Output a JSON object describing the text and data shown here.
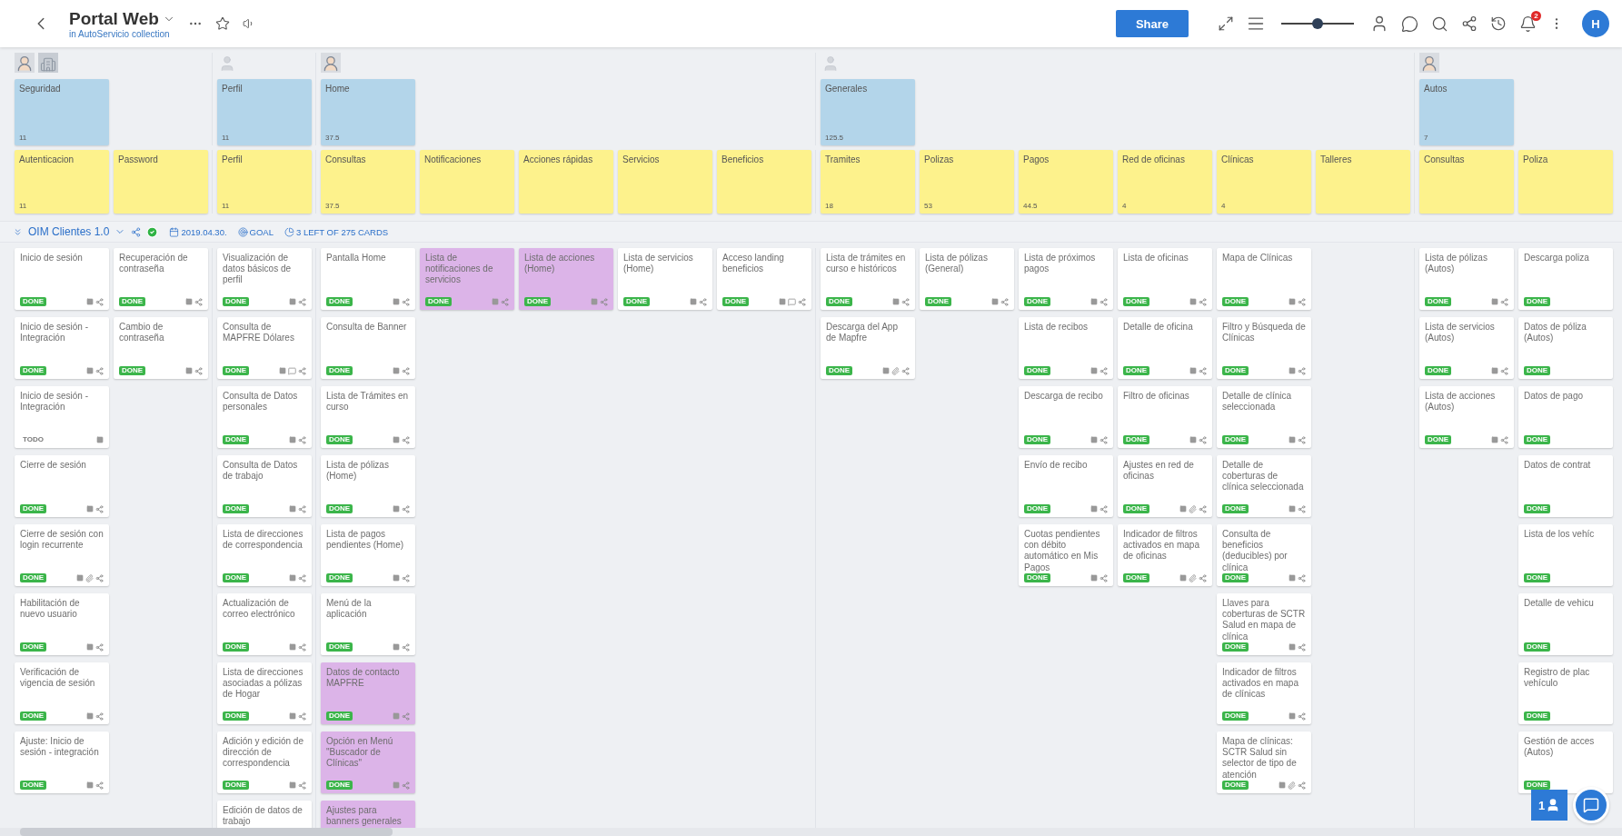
{
  "header": {
    "title": "Portal Web",
    "subtitle": "in AutoServicio collection",
    "share": "Share",
    "zoom": {
      "level": 0.5
    },
    "notifications": "2",
    "user_initial": "H"
  },
  "release": {
    "name": "OIM Clientes 1.0",
    "complete": true,
    "date": "2019.04.30.",
    "goal": "GOAL",
    "cards_left": "3 LEFT OF 275 CARDS"
  },
  "groups": [
    {
      "activity": {
        "title": "Seguridad",
        "value": "11"
      },
      "avatars": [
        {
          "kind": "person"
        },
        {
          "kind": "building"
        }
      ],
      "columns": [
        {
          "step": {
            "title": "Autenticacion",
            "value": "11"
          },
          "cards": [
            {
              "title": "Inicio de sesión",
              "status": "DONE",
              "done": true,
              "color": "#ffffff",
              "note": true,
              "share": true
            },
            {
              "title": "Inicio de sesión - Integración",
              "status": "DONE",
              "done": true,
              "color": "#ffffff",
              "note": true,
              "share": true
            },
            {
              "title": "Inicio de sesión - Integración",
              "status": "TODO",
              "done": false,
              "color": "#ffffff",
              "note": true
            },
            {
              "title": "Cierre de sesión",
              "status": "DONE",
              "done": true,
              "color": "#ffffff",
              "note": true,
              "share": true
            },
            {
              "title": "Cierre de sesión con login recurrente",
              "status": "DONE",
              "done": true,
              "color": "#ffffff",
              "note": true,
              "attachment": true,
              "share": true
            },
            {
              "title": "Habilitación de nuevo usuario",
              "status": "DONE",
              "done": true,
              "color": "#ffffff",
              "note": true,
              "share": true
            },
            {
              "title": "Verificación de vigencia de sesión",
              "status": "DONE",
              "done": true,
              "color": "#ffffff",
              "note": true,
              "share": true
            },
            {
              "title": "Ajuste: Inicio de sesión - integración",
              "status": "DONE",
              "done": true,
              "color": "#ffffff",
              "note": true,
              "share": true
            }
          ]
        },
        {
          "step": {
            "title": "Password"
          },
          "cards": [
            {
              "title": "Recuperación de contraseña",
              "status": "DONE",
              "done": true,
              "color": "#ffffff",
              "note": true,
              "share": true
            },
            {
              "title": "Cambio de contraseña",
              "status": "DONE",
              "done": true,
              "color": "#ffffff",
              "note": true,
              "share": true
            }
          ]
        }
      ]
    },
    {
      "activity": {
        "title": "Perfil",
        "value": "11"
      },
      "avatars": [
        {
          "kind": "placeholder"
        }
      ],
      "columns": [
        {
          "step": {
            "title": "Perfil",
            "value": "11"
          },
          "cards": [
            {
              "title": "Visualización de datos básicos de perfil",
              "status": "DONE",
              "done": true,
              "color": "#ffffff",
              "note": true,
              "share": true
            },
            {
              "title": "Consulta de MAPFRE Dólares",
              "status": "DONE",
              "done": true,
              "color": "#ffffff",
              "note": true,
              "comment": true,
              "share": true
            },
            {
              "title": "Consulta de Datos personales",
              "status": "DONE",
              "done": true,
              "color": "#ffffff",
              "note": true,
              "share": true
            },
            {
              "title": "Consulta de Datos de trabajo",
              "status": "DONE",
              "done": true,
              "color": "#ffffff",
              "note": true,
              "share": true
            },
            {
              "title": "Lista de direcciones de correspondencia",
              "status": "DONE",
              "done": true,
              "color": "#ffffff",
              "note": true,
              "share": true
            },
            {
              "title": "Actualización de correo electrónico",
              "status": "DONE",
              "done": true,
              "color": "#ffffff",
              "note": true,
              "share": true
            },
            {
              "title": "Lista de direcciones asociadas a pólizas de Hogar",
              "status": "DONE",
              "done": true,
              "color": "#ffffff",
              "note": true,
              "share": true
            },
            {
              "title": "Adición y edición de dirección de correspondencia",
              "status": "DONE",
              "done": true,
              "color": "#ffffff",
              "note": true,
              "share": true
            },
            {
              "title": "Edición de datos de trabajo",
              "color": "#ffffff"
            }
          ]
        }
      ]
    },
    {
      "activity": {
        "title": "Home",
        "value": "37.5"
      },
      "avatars": [
        {
          "kind": "person"
        }
      ],
      "columns": [
        {
          "step": {
            "title": "Consultas",
            "value": "37.5"
          },
          "cards": [
            {
              "title": "Pantalla Home",
              "status": "DONE",
              "done": true,
              "color": "#ffffff",
              "note": true,
              "share": true
            },
            {
              "title": "Consulta de Banner",
              "status": "DONE",
              "done": true,
              "color": "#ffffff",
              "note": true,
              "share": true
            },
            {
              "title": "Lista de Trámites en curso",
              "status": "DONE",
              "done": true,
              "color": "#ffffff",
              "note": true,
              "share": true
            },
            {
              "title": "Lista de pólizas (Home)",
              "status": "DONE",
              "done": true,
              "color": "#ffffff",
              "note": true,
              "share": true
            },
            {
              "title": "Lista de pagos pendientes (Home)",
              "status": "DONE",
              "done": true,
              "color": "#ffffff",
              "note": true,
              "share": true
            },
            {
              "title": "Menú de la aplicación",
              "status": "DONE",
              "done": true,
              "color": "#ffffff",
              "note": true,
              "share": true
            },
            {
              "title": "Datos de contacto MAPFRE",
              "status": "DONE",
              "done": true,
              "color": "#dcb4e8",
              "note": true,
              "share": true
            },
            {
              "title": "Opción en Menú \"Buscador de Clínicas\"",
              "status": "DONE",
              "done": true,
              "color": "#dcb4e8",
              "note": true,
              "share": true
            },
            {
              "title": "Ajustes para banners generales",
              "color": "#dcb4e8"
            }
          ]
        },
        {
          "step": {
            "title": "Notificaciones"
          },
          "cards": [
            {
              "title": "Lista de notificaciones de servicios",
              "status": "DONE",
              "done": true,
              "color": "#dcb4e8",
              "note": true,
              "share": true
            }
          ]
        },
        {
          "step": {
            "title": "Acciones rápidas"
          },
          "cards": [
            {
              "title": "Lista de acciones (Home)",
              "status": "DONE",
              "done": true,
              "color": "#dcb4e8",
              "note": true,
              "share": true
            }
          ]
        },
        {
          "step": {
            "title": "Servicios"
          },
          "cards": [
            {
              "title": "Lista de servicios (Home)",
              "status": "DONE",
              "done": true,
              "color": "#ffffff",
              "note": true,
              "share": true
            }
          ]
        },
        {
          "step": {
            "title": "Beneficios"
          },
          "cards": [
            {
              "title": "Acceso landing beneficios",
              "status": "DONE",
              "done": true,
              "color": "#ffffff",
              "note": true,
              "comment": true,
              "share": true
            }
          ]
        }
      ]
    },
    {
      "activity": {
        "title": "Generales",
        "value": "125.5"
      },
      "avatars": [
        {
          "kind": "placeholder"
        }
      ],
      "columns": [
        {
          "step": {
            "title": "Tramites",
            "value": "18"
          },
          "cards": [
            {
              "title": "Lista de trámites en curso e históricos",
              "status": "DONE",
              "done": true,
              "color": "#ffffff",
              "note": true,
              "share": true
            },
            {
              "title": "Descarga del App de Mapfre",
              "status": "DONE",
              "done": true,
              "color": "#ffffff",
              "note": true,
              "attachment": true,
              "share": true
            }
          ]
        },
        {
          "step": {
            "title": "Polizas",
            "value": "53"
          },
          "cards": [
            {
              "title": "Lista de pólizas (General)",
              "status": "DONE",
              "done": true,
              "color": "#ffffff",
              "note": true,
              "share": true
            }
          ]
        },
        {
          "step": {
            "title": "Pagos",
            "value": "44.5"
          },
          "cards": [
            {
              "title": "Lista de próximos pagos",
              "status": "DONE",
              "done": true,
              "color": "#ffffff",
              "note": true,
              "share": true
            },
            {
              "title": "Lista de recibos",
              "status": "DONE",
              "done": true,
              "color": "#ffffff",
              "note": true,
              "share": true
            },
            {
              "title": "Descarga de recibo",
              "status": "DONE",
              "done": true,
              "color": "#ffffff",
              "note": true,
              "share": true
            },
            {
              "title": "Envío de recibo",
              "status": "DONE",
              "done": true,
              "color": "#ffffff",
              "note": true,
              "share": true
            },
            {
              "title": "Cuotas pendientes con débito automático en Mis Pagos",
              "status": "DONE",
              "done": true,
              "color": "#ffffff",
              "note": true,
              "share": true
            }
          ]
        },
        {
          "step": {
            "title": "Red de oficinas",
            "value": "4"
          },
          "cards": [
            {
              "title": "Lista de oficinas",
              "status": "DONE",
              "done": true,
              "color": "#ffffff",
              "note": true,
              "share": true
            },
            {
              "title": "Detalle de oficina",
              "status": "DONE",
              "done": true,
              "color": "#ffffff",
              "note": true,
              "share": true
            },
            {
              "title": "Filtro de oficinas",
              "status": "DONE",
              "done": true,
              "color": "#ffffff",
              "note": true,
              "share": true
            },
            {
              "title": "Ajustes en red de oficinas",
              "status": "DONE",
              "done": true,
              "color": "#ffffff",
              "note": true,
              "attachment": true,
              "share": true
            },
            {
              "title": "Indicador de filtros activados en mapa de oficinas",
              "status": "DONE",
              "done": true,
              "color": "#ffffff",
              "note": true,
              "attachment": true,
              "share": true
            }
          ]
        },
        {
          "step": {
            "title": "Clínicas",
            "value": "4"
          },
          "cards": [
            {
              "title": "Mapa de Clínicas",
              "status": "DONE",
              "done": true,
              "color": "#ffffff",
              "note": true,
              "share": true
            },
            {
              "title": "Filtro y Búsqueda de Clínicas",
              "status": "DONE",
              "done": true,
              "color": "#ffffff",
              "note": true,
              "share": true
            },
            {
              "title": "Detalle de clínica seleccionada",
              "status": "DONE",
              "done": true,
              "color": "#ffffff",
              "note": true,
              "share": true
            },
            {
              "title": "Detalle de coberturas de clínica seleccionada",
              "status": "DONE",
              "done": true,
              "color": "#ffffff",
              "note": true,
              "share": true
            },
            {
              "title": "Consulta de beneficios (deducibles) por clínica",
              "status": "DONE",
              "done": true,
              "color": "#ffffff",
              "note": true,
              "share": true
            },
            {
              "title": "Llaves para coberturas de SCTR Salud en mapa de clínica",
              "status": "DONE",
              "done": true,
              "color": "#ffffff",
              "note": true,
              "share": true
            },
            {
              "title": "Indicador de filtros activados en mapa de clínicas",
              "status": "DONE",
              "done": true,
              "color": "#ffffff",
              "note": true,
              "share": true
            },
            {
              "title": "Mapa de clínicas: SCTR Salud sin selector de tipo de atención",
              "status": "DONE",
              "done": true,
              "color": "#ffffff",
              "note": true,
              "attachment": true,
              "share": true
            }
          ]
        },
        {
          "step": {
            "title": "Talleres"
          }
        }
      ]
    },
    {
      "activity": {
        "title": "Autos",
        "value": "7"
      },
      "avatars": [
        {
          "kind": "person"
        }
      ],
      "columns": [
        {
          "step": {
            "title": "Consultas"
          },
          "cards": [
            {
              "title": "Lista de pólizas (Autos)",
              "status": "DONE",
              "done": true,
              "color": "#ffffff",
              "note": true,
              "share": true
            },
            {
              "title": "Lista de servicios (Autos)",
              "status": "DONE",
              "done": true,
              "color": "#ffffff",
              "note": true,
              "share": true
            },
            {
              "title": "Lista de acciones (Autos)",
              "status": "DONE",
              "done": true,
              "color": "#ffffff",
              "note": true,
              "share": true
            }
          ]
        },
        {
          "step": {
            "title": "Poliza"
          },
          "cards": [
            {
              "title": "Descarga poliza",
              "status": "DONE",
              "done": true,
              "color": "#ffffff"
            },
            {
              "title": "Datos de póliza (Autos)",
              "status": "DONE",
              "done": true,
              "color": "#ffffff"
            },
            {
              "title": "Datos de pago",
              "status": "DONE",
              "done": true,
              "color": "#ffffff"
            },
            {
              "title": "Datos de contrat",
              "status": "DONE",
              "done": true,
              "color": "#ffffff"
            },
            {
              "title": "Lista de los vehíc",
              "status": "DONE",
              "done": true,
              "color": "#ffffff"
            },
            {
              "title": "Detalle de vehicu",
              "status": "DONE",
              "done": true,
              "color": "#ffffff"
            },
            {
              "title": "Registro de plac vehículo",
              "status": "DONE",
              "done": true,
              "color": "#ffffff"
            },
            {
              "title": "Gestión de acces (Autos)",
              "status": "DONE",
              "done": true,
              "color": "#ffffff"
            }
          ]
        }
      ]
    }
  ],
  "floating": {
    "users": "1"
  }
}
